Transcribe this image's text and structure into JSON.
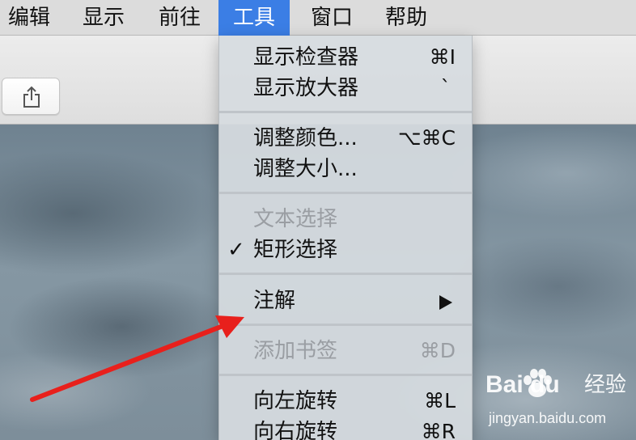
{
  "menubar": {
    "items": [
      {
        "label": "编辑"
      },
      {
        "label": "显示"
      },
      {
        "label": "前往"
      },
      {
        "label": "工具"
      },
      {
        "label": "窗口"
      },
      {
        "label": "帮助"
      }
    ],
    "active_index": 3
  },
  "toolbar": {
    "share_icon": "share-icon"
  },
  "tools_menu": {
    "items": [
      {
        "label": "显示检查器",
        "shortcut": "⌘I"
      },
      {
        "label": "显示放大器",
        "shortcut": "`"
      },
      {
        "label": "调整颜色...",
        "shortcut": "⌥⌘C"
      },
      {
        "label": "调整大小..."
      },
      {
        "label": "文本选择",
        "disabled": true
      },
      {
        "label": "矩形选择",
        "checked": true
      },
      {
        "label": "注解",
        "submenu": true
      },
      {
        "label": "添加书签",
        "shortcut": "⌘D",
        "disabled": true
      },
      {
        "label": "向左旋转",
        "shortcut": "⌘L"
      },
      {
        "label": "向右旋转",
        "shortcut": "⌘R"
      }
    ],
    "check_glyph": "✓"
  },
  "annotation": {
    "arrow_color": "#e8201c"
  },
  "watermark": {
    "brand": "Bai du",
    "brand_cn": "经验",
    "url": "jingyan.baidu.com"
  },
  "colors": {
    "menu_highlight": "#3b7ee5",
    "menu_background": "#d6dbe0",
    "disabled_text": "#9a9ea3"
  }
}
